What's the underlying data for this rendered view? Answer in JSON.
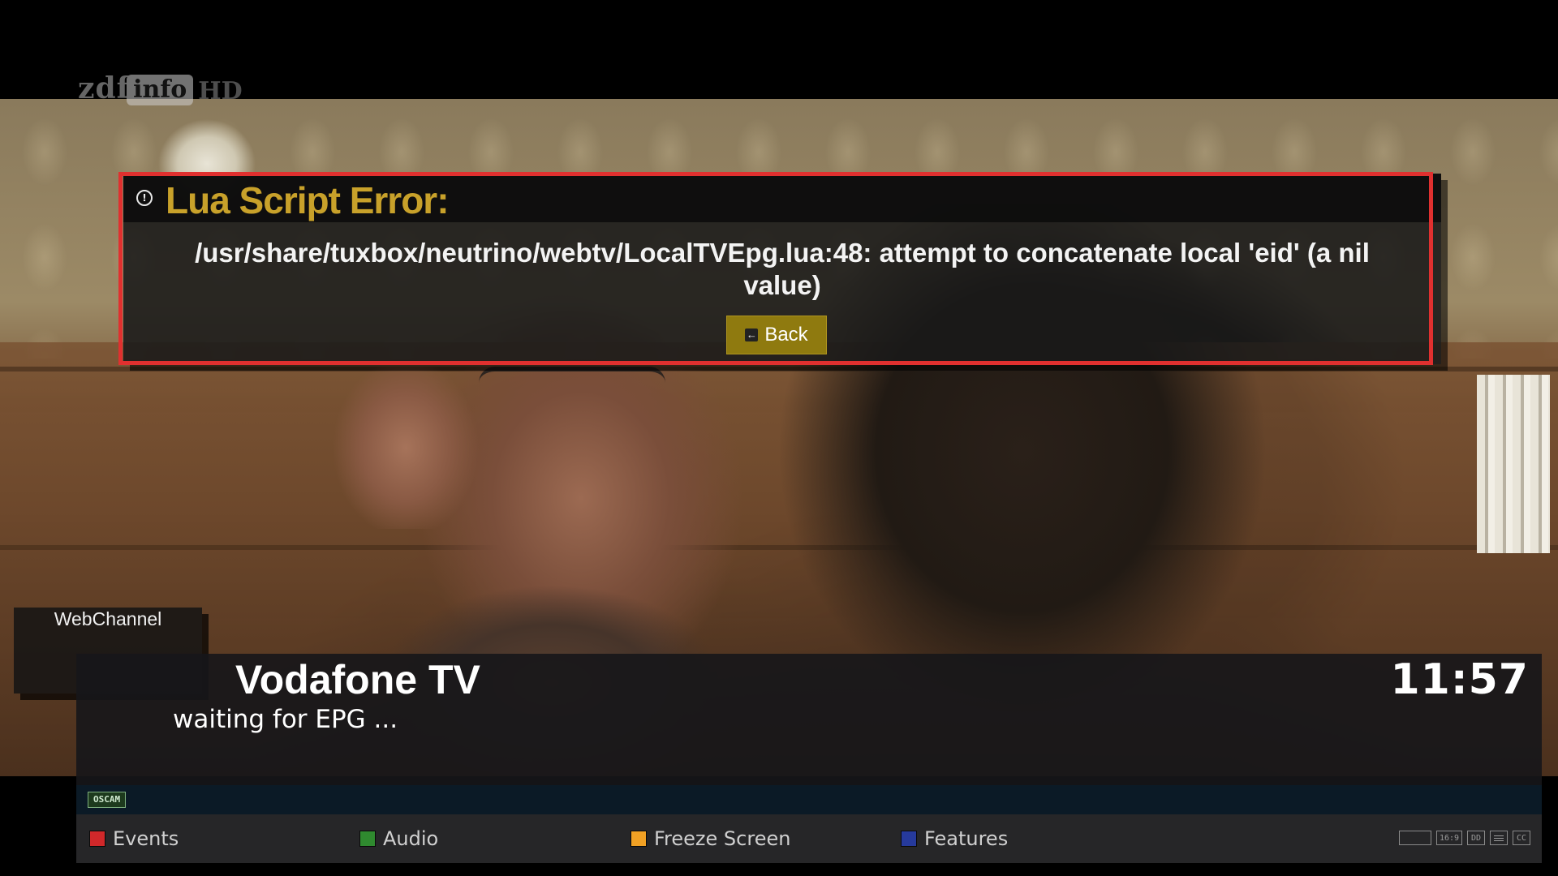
{
  "channel_logo": {
    "part1": "zdf",
    "part2": "info",
    "part3": "HD"
  },
  "error_dialog": {
    "icon": "info-icon",
    "title": "Lua Script Error:",
    "message": "/usr/share/tuxbox/neutrino/webtv/LocalTVEpg.lua:48: attempt to concatenate local 'eid' (a nil value)",
    "back_label": "Back",
    "highlight_color": "#e0302f",
    "title_color": "#c8a12a"
  },
  "infobar": {
    "webchannel_label": "WebChannel",
    "channel_name": "Vodafone TV",
    "epg_text": "waiting for EPG ...",
    "time": "11:57",
    "ca_badge": "OSCAM"
  },
  "color_buttons": [
    {
      "label": "Events",
      "color": "#d0282a"
    },
    {
      "label": "Audio",
      "color": "#2f8a2f"
    },
    {
      "label": "Freeze Screen",
      "color": "#f1a124"
    },
    {
      "label": "Features",
      "color": "#263a9c"
    }
  ],
  "status_icons": {
    "aspect": "16:9",
    "audio": "DD",
    "subtitle": "CC"
  }
}
